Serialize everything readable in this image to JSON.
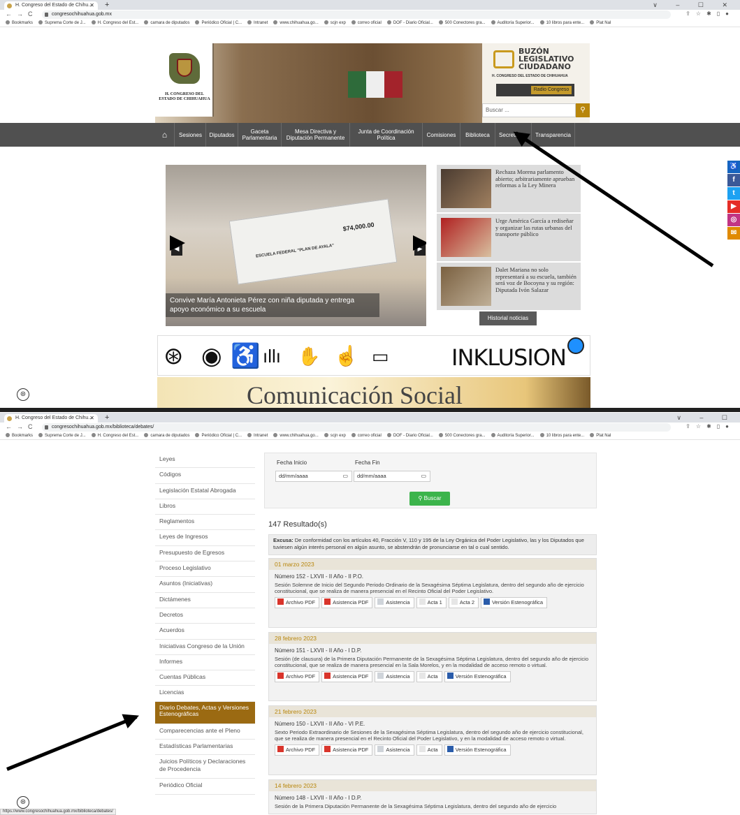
{
  "browser1": {
    "tab_title": "H. Congreso del Estado de Chihu...",
    "url": "congresochihuahua.gob.mx",
    "window_controls": "∨ – ☐ ✕"
  },
  "browser2": {
    "tab_title": "H. Congreso del Estado de Chihu...",
    "url": "congresochihuahua.gob.mx/biblioteca/debates/",
    "window_controls": "∨ – ☐"
  },
  "bookmarks": [
    "Bookmarks",
    "Suprema Corte de J...",
    "H. Congreso del Est...",
    "camara de diputados",
    "Periódico Oficial | C...",
    "Intranet",
    "www.chihuahua.go...",
    "scjn exp",
    "correo oficial",
    "DOF - Diario Oficial...",
    "500 Conectores gra...",
    "Auditoría Superior...",
    "10 libros para ente...",
    "Plat Nal"
  ],
  "header": {
    "seal_text": "H. CONGRESO DEL ESTADO DE CHIHUAHUA",
    "buzon_title": "BUZÓN\nLEGISLATIVO\nCIUDADANO",
    "buzon_sub": "H. CONGRESO DEL ESTADO DE CHIHUAHUA",
    "radio_label": "Radio Congreso",
    "search_placeholder": "Buscar ..."
  },
  "menu": [
    "Sesiones",
    "Diputados",
    "Gaceta Parlamentaria",
    "Mesa Directiva y Diputación Permanente",
    "Junta de Coordinación Política",
    "Comisiones",
    "Biblioteca",
    "Secretarías",
    "Transparencia"
  ],
  "slider": {
    "caption": "Convive María Antonieta Pérez con niña diputada y entrega apoyo económico a su escuela",
    "check_amount": "$74,000.00",
    "check_school": "ESCUELA FEDERAL \"PLAN DE AYALA\""
  },
  "news": [
    {
      "text": "Rechaza Morena parlamento abierto; arbitrariamente aprueban reformas a la Ley Minera"
    },
    {
      "text": "Urge América García a rediseñar y organizar las rutas urbanas del transporte público"
    },
    {
      "text": "Dalet Mariana no solo representará a su escuela, también será voz de Bocoyna y su región: Diputada Ivón Salazar"
    }
  ],
  "historial": "Historial noticias",
  "inklusion": "INKLUSION",
  "comsoc": "Comunicación Social",
  "sidebar": [
    "Leyes",
    "Códigos",
    "Legislación Estatal Abrogada",
    "Libros",
    "Reglamentos",
    "Leyes de Ingresos",
    "Presupuesto de Egresos",
    "Proceso Legislativo",
    "Asuntos (Iniciativas)",
    "Dictámenes",
    "Decretos",
    "Acuerdos",
    "Iniciativas Congreso de la Unión",
    "Informes",
    "Cuentas Públicas",
    "Licencias",
    "Diario Debates, Actas y Versiones Estenográficas",
    "Comparecencias ante el Pleno",
    "Estadísticas Parlamentarias",
    "Juicios Políticos y Declaraciones de Procedencia",
    "Periódico Oficial"
  ],
  "filter": {
    "start_label": "Fecha Inicio",
    "end_label": "Fecha Fin",
    "date_placeholder": "dd/mm/aaaa",
    "search_button": "Buscar"
  },
  "results": "147 Resultado(s)",
  "excusa": {
    "label": "Excusa:",
    "text": "De conformidad con los artículos 40, Fracción V, 110 y 195 de la Ley Orgánica del Poder Legislativo, las y los Diputados que tuviesen algún interés personal en algún asunto, se abstendrán de pronunciarse en tal o cual sentido."
  },
  "entries": [
    {
      "date": "01 marzo 2023",
      "number": "Número 152 - LXVII - II Año - II P.O.",
      "desc": "Sesión Solemne de Inicio del Segundo Periodo Ordinario de la Sexagésima Séptima Legislatura, dentro del segundo año de ejercicio constitucional, que se realiza de manera presencial en el Recinto Oficial del Poder Legislativo.",
      "buttons": [
        "Archivo PDF",
        "Asistencia PDF",
        "Asistencia",
        "Acta 1",
        "Acta 2",
        "Versión Estenográfica"
      ]
    },
    {
      "date": "28 febrero 2023",
      "number": "Número 151 - LXVII - II Año - I D.P.",
      "desc": "Sesión (de clausura) de la Primera Diputación Permanente de la Sexagésima Séptima Legislatura, dentro del segundo año de ejercicio constitucional, que se realiza de manera presencial en la Sala Morelos, y en la modalidad de acceso remoto o virtual.",
      "buttons": [
        "Archivo PDF",
        "Asistencia PDF",
        "Asistencia",
        "Acta",
        "Versión Estenográfica"
      ]
    },
    {
      "date": "21 febrero 2023",
      "number": "Número 150 - LXVII - II Año - VI P.E.",
      "desc": "Sexto Periodo Extraordinario de Sesiones de la Sexagésima Séptima Legislatura, dentro del segundo año de ejercicio constitucional, que se realiza de manera presencial en el Recinto Oficial del Poder Legislativo, y en la modalidad de acceso remoto o virtual.",
      "buttons": [
        "Archivo PDF",
        "Asistencia PDF",
        "Asistencia",
        "Acta",
        "Versión Estenográfica"
      ]
    },
    {
      "date": "14 febrero 2023",
      "number": "Número 148 - LXVII - II Año - I D.P.",
      "desc": "Sesión de la Primera Diputación Permanente de la Sexagésima Séptima Legislatura, dentro del segundo año de ejercicio",
      "buttons": []
    }
  ],
  "status_url": "https://www.congresochihuahua.gob.mx/biblioteca/debates/",
  "colors": {
    "menu_bg": "#505050",
    "active_sidebar": "#9b6a12",
    "buscar_green": "#3cb44b",
    "date_gold": "#b8860b"
  }
}
